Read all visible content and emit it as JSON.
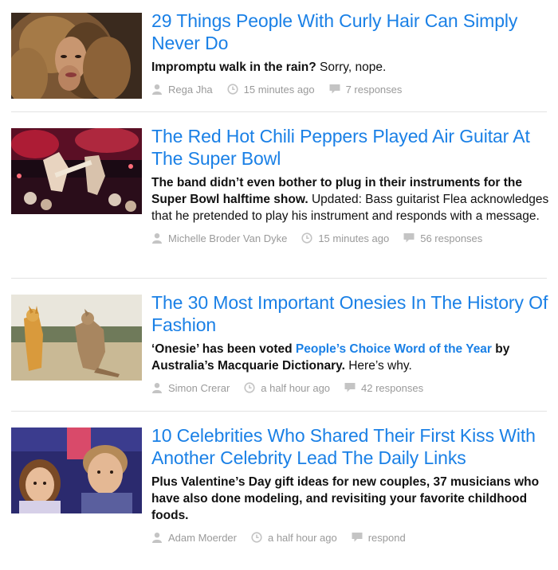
{
  "stories": [
    {
      "headline": "29 Things People With Curly Hair Can Simply Never Do",
      "dek_bold": "Impromptu walk in the rain?",
      "dek_rest": " Sorry, nope.",
      "author": "Rega Jha",
      "time": "15 minutes ago",
      "responses": "7 responses"
    },
    {
      "headline": "The Red Hot Chili Peppers Played Air Guitar At The Super Bowl",
      "dek_bold": "The band didn’t even bother to plug in their instruments for the Super Bowl halftime show.",
      "dek_rest": " Updated: Bass guitarist Flea acknowledges that he pretended to play his instrument and responds with a message.",
      "author": "Michelle Broder Van Dyke",
      "time": "15 minutes ago",
      "responses": "56 responses"
    },
    {
      "headline": "The 30 Most Important Onesies In The History Of Fashion",
      "dek_bold_1": "‘Onesie’ has been voted ",
      "dek_link": "People’s Choice Word of the Year",
      "dek_bold_2": " by Australia’s Macquarie Dictionary.",
      "dek_rest": " Here’s why.",
      "author": "Simon Crerar",
      "time": "a half hour ago",
      "responses": "42 responses"
    },
    {
      "headline": "10 Celebrities Who Shared Their First Kiss With Another Celebrity Lead The Daily Links",
      "dek_bold": "Plus Valentine’s Day gift ideas for new couples, 37 musicians who have also done modeling, and revisiting your favorite childhood foods.",
      "author": "Adam Moerder",
      "time": "a half hour ago",
      "responses": "respond"
    }
  ],
  "icons": {
    "author": "user-icon",
    "time": "clock-icon",
    "responses": "comment-icon"
  },
  "colors": {
    "link": "#1a80e6",
    "meta": "#9a9a9a",
    "divider": "#e3e3e3"
  }
}
